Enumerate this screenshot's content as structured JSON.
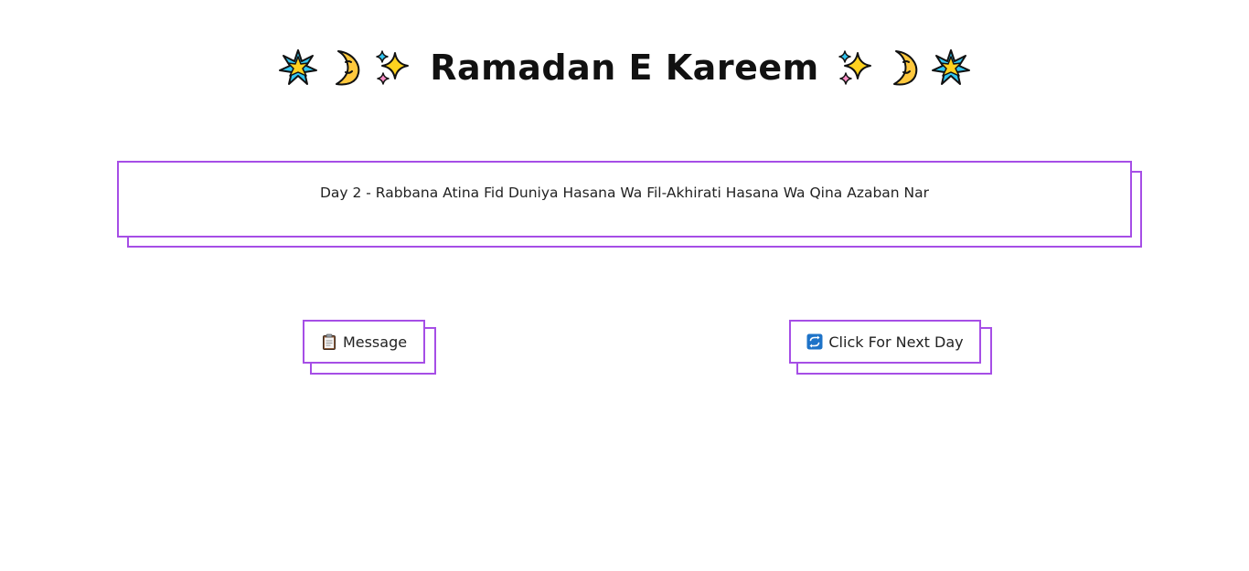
{
  "header": {
    "title": "Ramadan E Kareem",
    "left_icons": [
      "glowing-star-icon",
      "crescent-moon-face-icon",
      "sparkles-icon"
    ],
    "right_icons": [
      "sparkles-icon",
      "crescent-moon-face-icon",
      "glowing-star-icon"
    ]
  },
  "message_card": {
    "text": "Day 2 - Rabbana Atina Fid Duniya Hasana Wa Fil-Akhirati Hasana Wa Qina Azaban Nar"
  },
  "buttons": {
    "message_label": "Message",
    "message_icon": "clipboard-icon",
    "next_label": "Click For Next Day",
    "next_icon": "refresh-icon"
  },
  "colors": {
    "accent": "#a64ee6",
    "background": "#ffffff",
    "text": "#111111"
  }
}
